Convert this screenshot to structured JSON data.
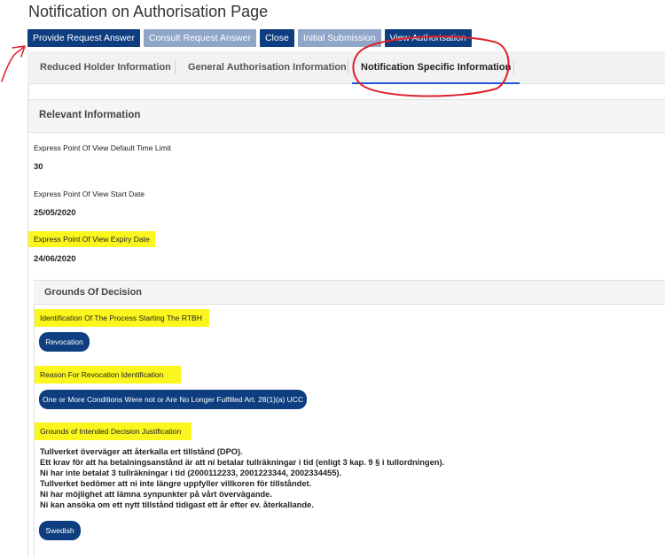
{
  "page": {
    "title": "Notification on Authorisation Page"
  },
  "toolbar": {
    "buttons": [
      {
        "label": "Provide Request Answer",
        "state": "enabled"
      },
      {
        "label": "Consult Request Answer",
        "state": "disabled"
      },
      {
        "label": "Close",
        "state": "enabled"
      },
      {
        "label": "Initial Submission",
        "state": "disabled"
      },
      {
        "label": "View Authorisation",
        "state": "enabled"
      }
    ]
  },
  "tabs": [
    {
      "label": "Reduced Holder Information",
      "active": false
    },
    {
      "label": "General Authorisation Information",
      "active": false
    },
    {
      "label": "Notification Specific Information",
      "active": true
    }
  ],
  "relevant_info": {
    "heading": "Relevant Information",
    "fields": [
      {
        "label": "Express Point Of View Default Time Limit",
        "value": "30",
        "highlighted": false
      },
      {
        "label": "Express Point Of View Start Date",
        "value": "25/05/2020",
        "highlighted": false
      },
      {
        "label": "Express Point Of View Expiry Date",
        "value": "24/06/2020",
        "highlighted": true
      }
    ]
  },
  "grounds": {
    "heading": "Grounds Of Decision",
    "process_label": "Identification Of The Process Starting The RTBH",
    "process_value": "Revocation",
    "reason_label": "Reason For Revocation Identification",
    "reason_value": "One or More Conditions Were not or Are No Longer Fulfilled Art. 28(1)(a) UCC",
    "justification_label": "Grounds of Intended Decision Justification",
    "justification_lines": [
      "Tullverket överväger att återkalla ert tillstånd (DPO).",
      "Ett krav för att ha betalningsanstånd är att ni betalar tullräkningar i tid (enligt 3 kap. 9 § i tullordningen).",
      "Ni har inte betalat 3 tullräkningar i tid (2000112233, 2001223344, 2002334455).",
      "Tullverket bedömer att ni inte längre uppfyller villkoren för tillståndet.",
      "Ni har möjlighet att lämna synpunkter på vårt övervägande.",
      "Ni kan ansöka om ett nytt tillstånd tidigast ett år efter ev. återkallande."
    ],
    "language": "Swedish"
  },
  "colors": {
    "primary_button": "#0e3e7f",
    "disabled_button": "#8fa6c9",
    "highlight": "#fbf61e",
    "annotation": "#e0202a",
    "active_tab_underline": "#2456d8"
  }
}
